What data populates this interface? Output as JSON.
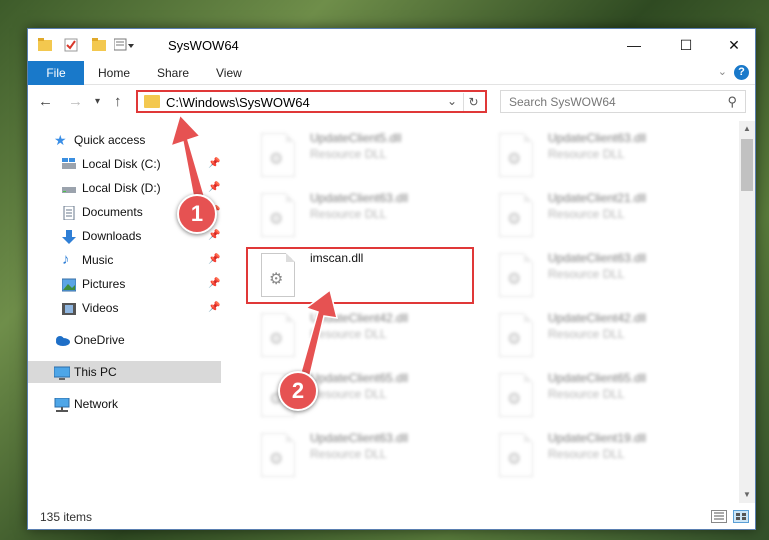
{
  "window": {
    "title": "SysWOW64",
    "controls": {
      "minimize": "—",
      "maximize": "☐",
      "close": "✕"
    }
  },
  "ribbon": {
    "tabs": [
      "File",
      "Home",
      "Share",
      "View"
    ],
    "help": "?"
  },
  "nav": {
    "address": "C:\\Windows\\SysWOW64",
    "search_placeholder": "Search SysWOW64"
  },
  "sidebar": {
    "items": [
      {
        "label": "Quick access",
        "icon": "star-icon",
        "pinned": false
      },
      {
        "label": "Local Disk (C:)",
        "icon": "drive-icon",
        "pinned": true
      },
      {
        "label": "Local Disk (D:)",
        "icon": "drive-icon",
        "pinned": true
      },
      {
        "label": "Documents",
        "icon": "document-icon",
        "pinned": true
      },
      {
        "label": "Downloads",
        "icon": "download-arrow-icon",
        "pinned": true
      },
      {
        "label": "Music",
        "icon": "music-note-icon",
        "pinned": true
      },
      {
        "label": "Pictures",
        "icon": "picture-icon",
        "pinned": true
      },
      {
        "label": "Videos",
        "icon": "film-icon",
        "pinned": true
      },
      {
        "label": "OneDrive",
        "icon": "cloud-icon",
        "pinned": false
      },
      {
        "label": "This PC",
        "icon": "monitor-icon",
        "pinned": false
      },
      {
        "label": "Network",
        "icon": "network-icon",
        "pinned": false
      }
    ]
  },
  "files": {
    "highlighted": {
      "name": "imscan.dll"
    },
    "left_column": [
      {
        "name": "UpdateClient5.dll",
        "type": "Resource DLL"
      },
      {
        "name": "UpdateClient63.dll",
        "type": "Resource DLL"
      },
      {
        "name": "UpdateClient42.dll",
        "type": "Resource DLL"
      },
      {
        "name": "UpdateClient65.dll",
        "type": "Resource DLL"
      },
      {
        "name": "UpdateClient63.dll",
        "type": "Resource DLL"
      }
    ],
    "right_column": [
      {
        "name": "UpdateClient63.dll",
        "type": "Resource DLL"
      },
      {
        "name": "UpdateClient21.dll",
        "type": "Resource DLL"
      },
      {
        "name": "UpdateClient63.dll",
        "type": "Resource DLL"
      },
      {
        "name": "UpdateClient42.dll",
        "type": "Resource DLL"
      },
      {
        "name": "UpdateClient65.dll",
        "type": "Resource DLL"
      },
      {
        "name": "UpdateClient19.dll",
        "type": "Resource DLL"
      }
    ]
  },
  "status": {
    "item_count": "135 items"
  },
  "annotations": {
    "step1": "1",
    "step2": "2",
    "color": "#e65252"
  }
}
